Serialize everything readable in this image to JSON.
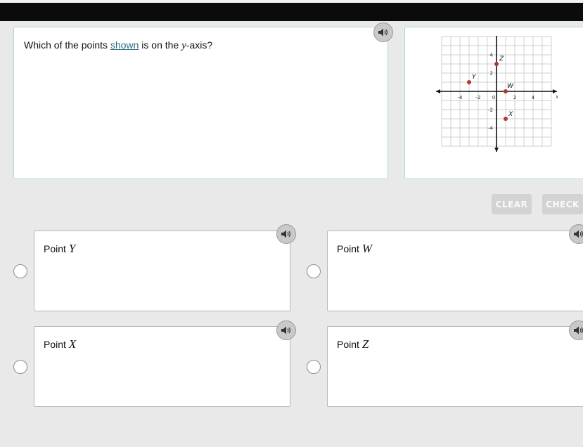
{
  "question": {
    "prefix": "Which of the points ",
    "link": "shown",
    "middle": " is on the ",
    "variable": "y",
    "suffix": "-axis?"
  },
  "graph": {
    "axis_x_label": "x",
    "axis_y_label": "y",
    "x_ticks": [
      "-4",
      "-2",
      "0",
      "2",
      "4"
    ],
    "y_ticks": [
      "4",
      "2",
      "-2",
      "-4"
    ],
    "points": [
      {
        "label": "Y",
        "x": -3,
        "y": 1
      },
      {
        "label": "Z",
        "x": 0,
        "y": 3
      },
      {
        "label": "W",
        "x": 1,
        "y": 0
      },
      {
        "label": "X",
        "x": 1,
        "y": -3
      }
    ],
    "point_color": "#b0392c"
  },
  "buttons": {
    "clear": "CLEAR",
    "check": "CHECK"
  },
  "answers": [
    {
      "prefix": "Point ",
      "var": "Y"
    },
    {
      "prefix": "Point ",
      "var": "W"
    },
    {
      "prefix": "Point ",
      "var": "X"
    },
    {
      "prefix": "Point ",
      "var": "Z"
    }
  ],
  "icons": {
    "audio": "speaker-icon",
    "radio": "radio-button"
  }
}
